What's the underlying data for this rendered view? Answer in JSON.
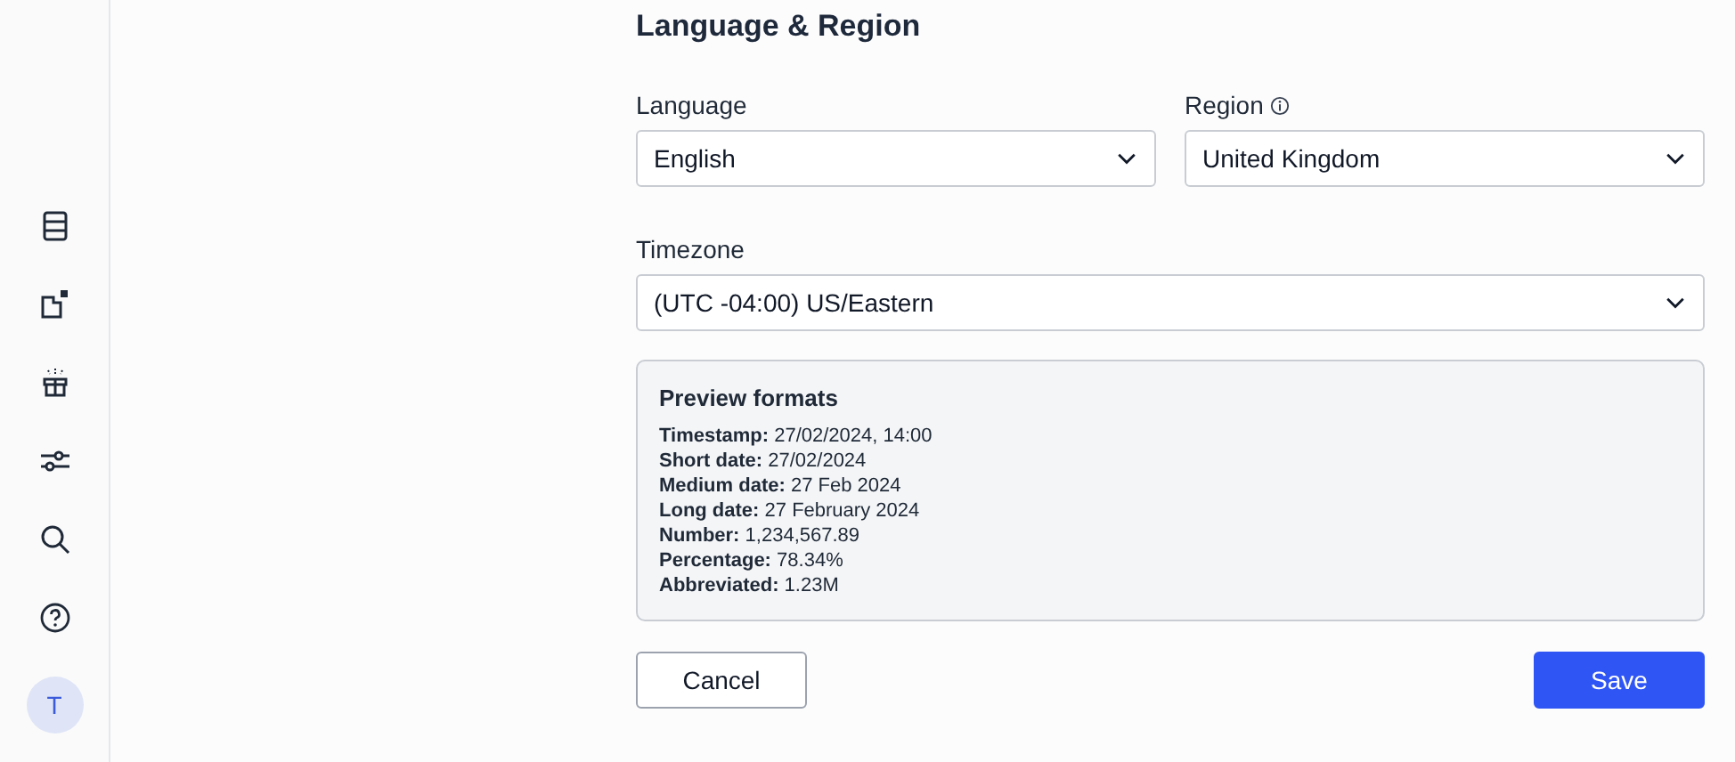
{
  "sidebar": {
    "avatar": "T"
  },
  "section": {
    "title": "Language & Region"
  },
  "fields": [
    {
      "label": "Language",
      "value": "English",
      "info": false
    },
    {
      "label": "Region",
      "value": "United Kingdom",
      "info": true
    },
    {
      "label": "Timezone",
      "value": "(UTC -04:00) US/Eastern",
      "info": false
    }
  ],
  "preview": {
    "title": "Preview formats",
    "lines": [
      "**Timestamp:** 27/02/2024, 14:00",
      "**Short date:** 27/02/2024",
      "**Medium date:** 27 Feb 2024",
      "**Long date:** 27 February 2024",
      "**Number:** 1,234,567.89",
      "**Percentage:** 78.34%",
      "**Abbreviated:** 1.23M"
    ]
  },
  "buttons": [
    {
      "label": "Cancel",
      "kind": "secondary"
    },
    {
      "label": "Save",
      "kind": "primary"
    }
  ]
}
